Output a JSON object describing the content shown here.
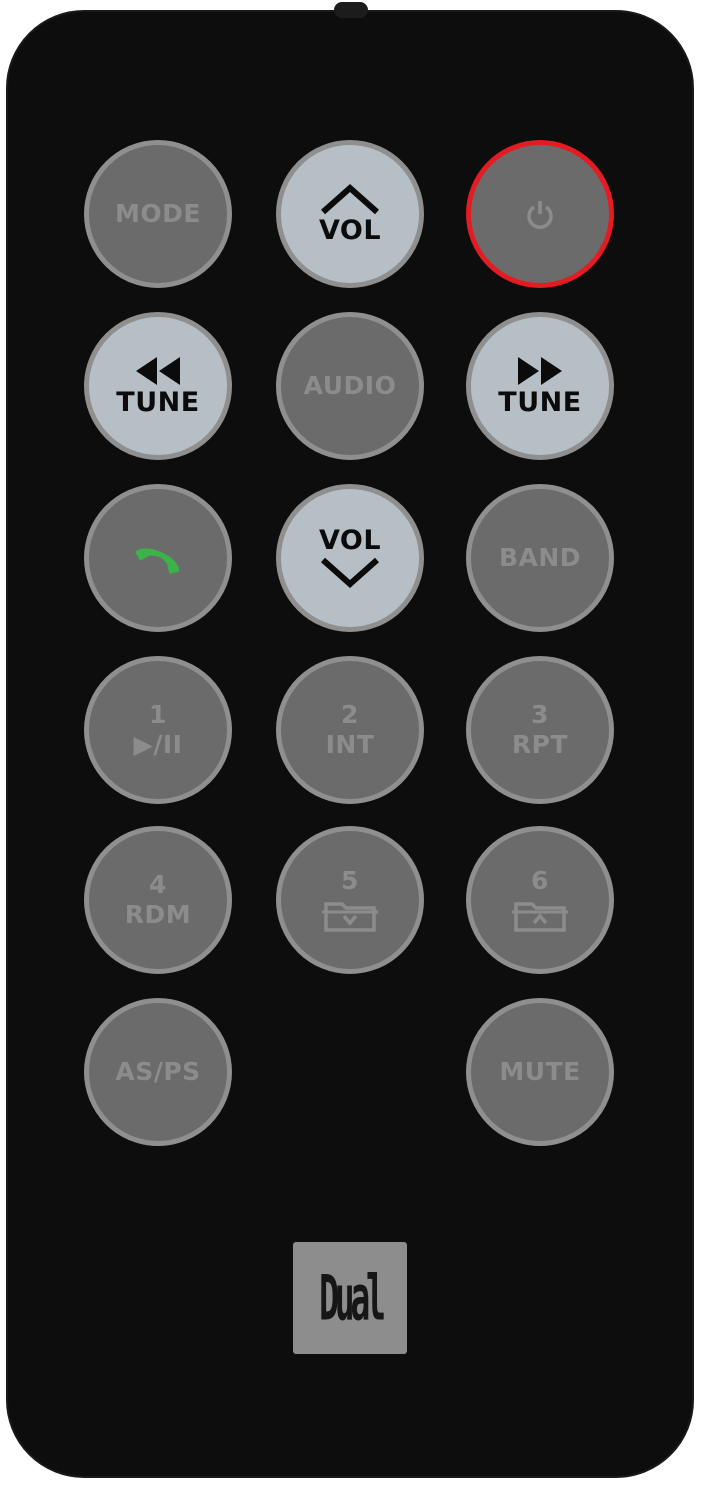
{
  "brand": {
    "logo_text": "Dual"
  },
  "colors": {
    "body": "#0d0d0d",
    "button_gray": "#6b6b6b",
    "button_light": "#b7bfc6",
    "power_ring": "#e31b23",
    "call_green": "#3cb34a"
  },
  "buttons": {
    "mode": {
      "label": "MODE"
    },
    "vol_up": {
      "label": "VOL",
      "icon": "chevron-up-icon"
    },
    "power": {
      "icon": "power-icon"
    },
    "tune_prev": {
      "label": "TUNE",
      "icon": "rewind-icon"
    },
    "audio": {
      "label": "AUDIO"
    },
    "tune_next": {
      "label": "TUNE",
      "icon": "fast-forward-icon"
    },
    "call": {
      "icon": "phone-icon"
    },
    "vol_down": {
      "label": "VOL",
      "icon": "chevron-down-icon"
    },
    "band": {
      "label": "BAND"
    },
    "b1": {
      "number": "1",
      "label": "▶/II"
    },
    "b2": {
      "number": "2",
      "label": "INT"
    },
    "b3": {
      "number": "3",
      "label": "RPT"
    },
    "b4": {
      "number": "4",
      "label": "RDM"
    },
    "b5": {
      "number": "5",
      "icon": "folder-down-icon"
    },
    "b6": {
      "number": "6",
      "icon": "folder-up-icon"
    },
    "asps": {
      "label": "AS/PS"
    },
    "mute": {
      "label": "MUTE"
    }
  }
}
